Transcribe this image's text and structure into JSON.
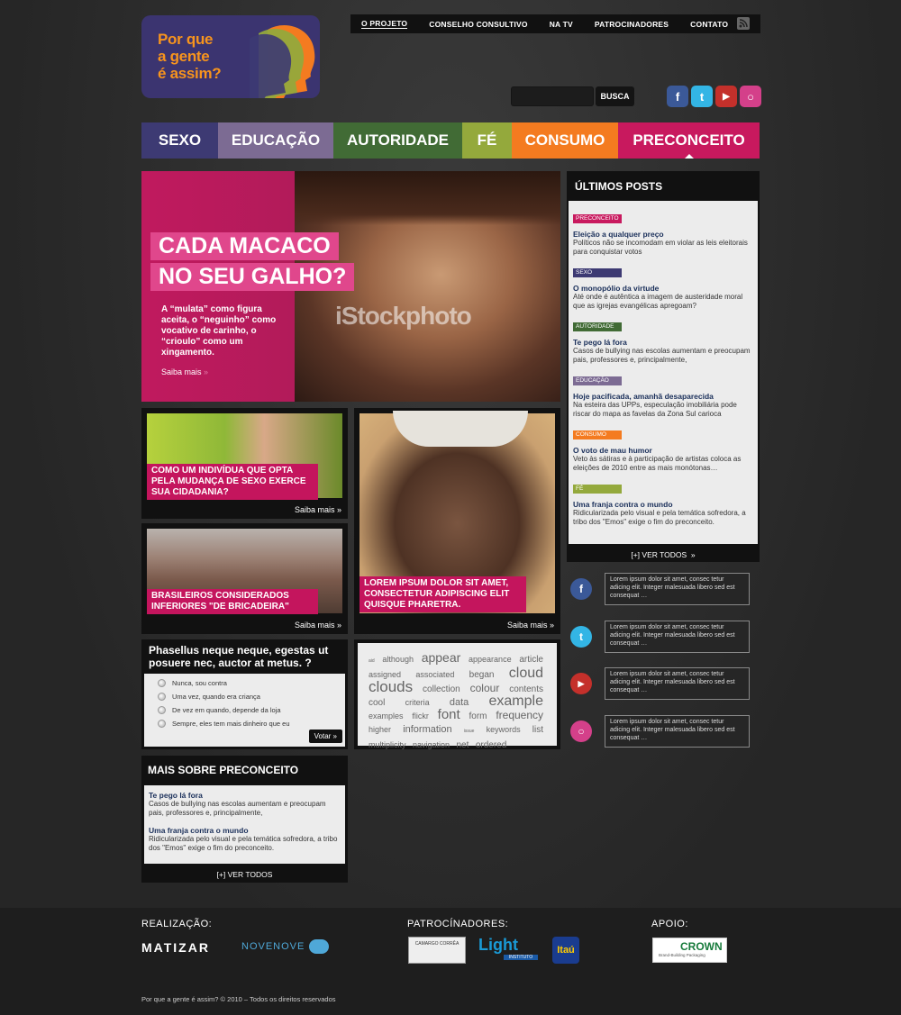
{
  "logo": {
    "text": "Por que\na gente\né assim?"
  },
  "topnav": [
    "O PROJETO",
    "CONSELHO CONSULTIVO",
    "NA TV",
    "PATROCINADORES",
    "CONTATO"
  ],
  "search": {
    "button": "BUSCA"
  },
  "social_top": [
    {
      "icon": "facebook-icon",
      "glyph": "f",
      "color": "#3b5998"
    },
    {
      "icon": "twitter-icon",
      "glyph": "t",
      "color": "#33b5e5"
    },
    {
      "icon": "youtube-icon",
      "glyph": "▶",
      "color": "#c4302b"
    },
    {
      "icon": "orkut-icon",
      "glyph": "○",
      "color": "#d4408a"
    }
  ],
  "categories": [
    {
      "label": "SEXO",
      "color": "#3d3a73"
    },
    {
      "label": "EDUCAÇÃO",
      "color": "#7c6b93"
    },
    {
      "label": "AUTORIDADE",
      "color": "#416b35"
    },
    {
      "label": "FÉ",
      "color": "#94a93c"
    },
    {
      "label": "CONSUMO",
      "color": "#f47b20"
    },
    {
      "label": "PRECONCEITO",
      "color": "#c8195e"
    }
  ],
  "hero": {
    "title_line1": "CADA MACACO",
    "title_line2": "NO SEU GALHO?",
    "watermark": "iStockphoto",
    "description": "A “mulata” como figura aceita, o “neguinho” como vocativo de carinho, o “crioulo” como um xingamento.",
    "more": "Saiba mais"
  },
  "tiles": [
    {
      "caption": "COMO UM INDIVÍDUA QUE OPTA PELA MUDANÇA DE SEXO EXERCE SUA CIDADANIA?",
      "more": "Saiba mais"
    },
    {
      "caption": "BRASILEIROS CONSIDERADOS INFERIORES \"DE BRICADEIRA\"",
      "more": "Saiba mais"
    },
    {
      "caption": "LOREM IPSUM DOLOR SIT AMET, CONSECTETUR ADIPISCING ELIT QUISQUE PHARETRA.",
      "more": "Saiba mais"
    }
  ],
  "poll": {
    "question": "Phasellus neque neque, egestas ut posuere nec, auctor at metus.  ?",
    "options": [
      "Nunca, sou contra",
      "Uma vez, quando era criança",
      "De vez em quando, depende da loja",
      "Sempre, eles tem mais dinheiro que eu"
    ],
    "vote": "Votar"
  },
  "tagcloud": [
    {
      "w": "aid",
      "s": 5
    },
    {
      "w": "although",
      "s": 9
    },
    {
      "w": "appear",
      "s": 14
    },
    {
      "w": "appearance",
      "s": 9
    },
    {
      "w": "article",
      "s": 10
    },
    {
      "w": "assigned",
      "s": 9
    },
    {
      "w": "associated",
      "s": 9
    },
    {
      "w": "began",
      "s": 10
    },
    {
      "w": "cloud",
      "s": 16
    },
    {
      "w": "clouds",
      "s": 17
    },
    {
      "w": "collection",
      "s": 10
    },
    {
      "w": "colour",
      "s": 12
    },
    {
      "w": "contents",
      "s": 10
    },
    {
      "w": "cool",
      "s": 10
    },
    {
      "w": "criteria",
      "s": 9
    },
    {
      "w": "data",
      "s": 11
    },
    {
      "w": "example",
      "s": 16
    },
    {
      "w": "examples",
      "s": 9
    },
    {
      "w": "flickr",
      "s": 9
    },
    {
      "w": "font",
      "s": 15
    },
    {
      "w": "form",
      "s": 10
    },
    {
      "w": "frequency",
      "s": 12
    },
    {
      "w": "higher",
      "s": 9
    },
    {
      "w": "information",
      "s": 11
    },
    {
      "w": "issue",
      "s": 5
    },
    {
      "w": "keywords",
      "s": 9
    },
    {
      "w": "list",
      "s": 10
    },
    {
      "w": "multiplicity",
      "s": 9
    },
    {
      "w": "navigation",
      "s": 9
    },
    {
      "w": "net",
      "s": 10
    },
    {
      "w": "ordered",
      "s": 10
    }
  ],
  "more_about": {
    "title": "MAIS SOBRE PRECONCEITO",
    "items": [
      {
        "title": "Te pego lá fora",
        "desc": "Casos de bullying nas escolas aumentam e preocupam pais, professores e, principalmente,"
      },
      {
        "title": "Uma franja contra o mundo",
        "desc": "Ridicularizada pelo visual e pela temática sofredora, a tribo dos \"Emos\" exige o fim do preconceito."
      }
    ],
    "see_all": "[+]  VER TODOS"
  },
  "latest": {
    "title": "ÚLTIMOS POSTS",
    "posts": [
      {
        "badge": "PRECONCEITO",
        "color": "#c8195e",
        "title": "Eleição a qualquer preço",
        "desc": "Políticos não se incomodam em violar as leis eleitorais para conquistar votos"
      },
      {
        "badge": "SEXO",
        "color": "#3d3a73",
        "title": "O monopólio da virtude",
        "desc": "Até onde é autêntica a imagem de austeridade moral que as igrejas evangélicas apregoam?"
      },
      {
        "badge": "AUTORIDADE",
        "color": "#416b35",
        "title": "Te pego lá fora",
        "desc": "Casos de bullying nas escolas aumentam e preocupam pais, professores e, principalmente,"
      },
      {
        "badge": "EDUCAÇÃO",
        "color": "#7c6b93",
        "title": "Hoje pacificada, amanhã desaparecida",
        "desc": "Na esteira das UPPs, especulação imobiliária pode riscar do mapa as favelas da Zona Sul carioca"
      },
      {
        "badge": "CONSUMO",
        "color": "#f47b20",
        "title": "O voto de mau humor",
        "desc": "Veto às sátiras e à participação de artistas coloca as eleições de 2010 entre as mais monótonas…"
      },
      {
        "badge": "FÉ",
        "color": "#94a93c",
        "title": "Uma franja contra o mundo",
        "desc": "Ridicularizada pelo visual e pela temática sofredora, a tribo dos \"Emos\" exige o fim do preconceito."
      }
    ],
    "see_all": "[+]  VER TODOS"
  },
  "feeds": [
    {
      "icon": "facebook-icon",
      "glyph": "f",
      "color": "#3b5998",
      "text": "Lorem ipsum dolor sit amet, consec tetur adicing elit. Integer malesuada libero sed est consequat …"
    },
    {
      "icon": "twitter-icon",
      "glyph": "t",
      "color": "#33b5e5",
      "text": "Lorem ipsum dolor sit amet, consec tetur adicing elit. Integer malesuada libero sed est consequat …"
    },
    {
      "icon": "youtube-icon",
      "glyph": "▶",
      "color": "#c4302b",
      "text": "Lorem ipsum dolor sit amet, consec tetur adicing elit. Integer malesuada libero sed est consequat …"
    },
    {
      "icon": "orkut-icon",
      "glyph": "○",
      "color": "#d4408a",
      "text": "Lorem ipsum dolor sit amet, consec tetur adicing elit. Integer malesuada libero sed est consequat …"
    }
  ],
  "footer": {
    "realizacao": "REALIZAÇÃO:",
    "patrocinadores": "PATROCÍNADORES:",
    "apoio": "APOIO:",
    "logos": {
      "matizar": "MATIZAR",
      "novenove": "NOVENOVE",
      "camargo": "CAMARGO CORRÊA",
      "light": "Light",
      "light_sub": "INSTITUTO",
      "itau": "Itaú",
      "crown": "CROWN",
      "crown_sub": "Brand-Building Packaging"
    },
    "copyright": "Por que a gente é assim? © 2010 – Todos os direitos reservados"
  }
}
